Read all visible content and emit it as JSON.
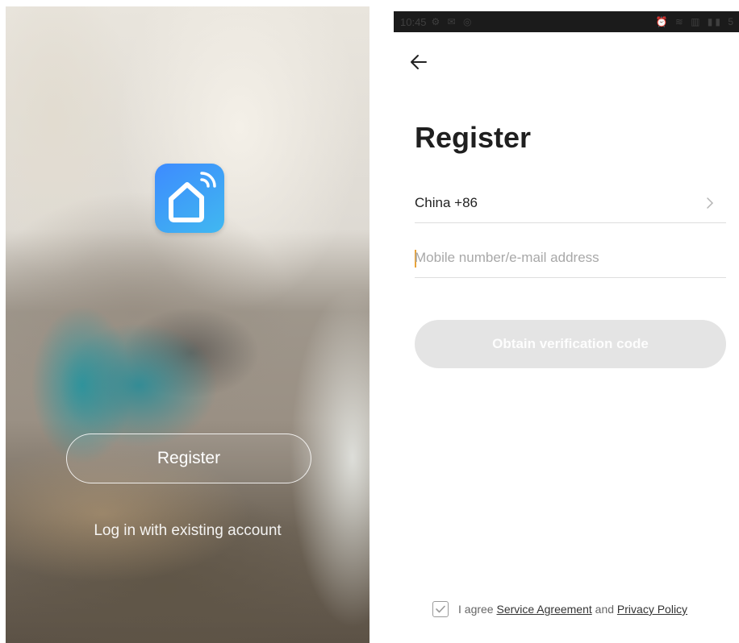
{
  "welcome": {
    "app_icon": "smart-home-wifi-icon",
    "register_label": "Register",
    "login_label": "Log in with existing account",
    "colors": {
      "logo_start": "#3d8bff",
      "logo_end": "#41b8f1"
    }
  },
  "register_screen": {
    "status_bar": {
      "time": "10:45",
      "left_icons": "⚙ ✉ ◎",
      "right_icons": "⏰ ≋ ▥ ▮▮ 5"
    },
    "back_icon": "arrow-left-icon",
    "title": "Register",
    "country": {
      "label": "China +86",
      "chevron_icon": "chevron-right-icon"
    },
    "mobile_field": {
      "placeholder": "Mobile number/e-mail address",
      "value": ""
    },
    "obtain_button": "Obtain verification code",
    "agreement": {
      "checked": true,
      "prefix": "I agree",
      "service_link": "Service Agreement",
      "conjunction": "and",
      "privacy_link": "Privacy Policy"
    },
    "colors": {
      "button_disabled": "#e4e4e4",
      "caret": "#e8a33a"
    }
  }
}
